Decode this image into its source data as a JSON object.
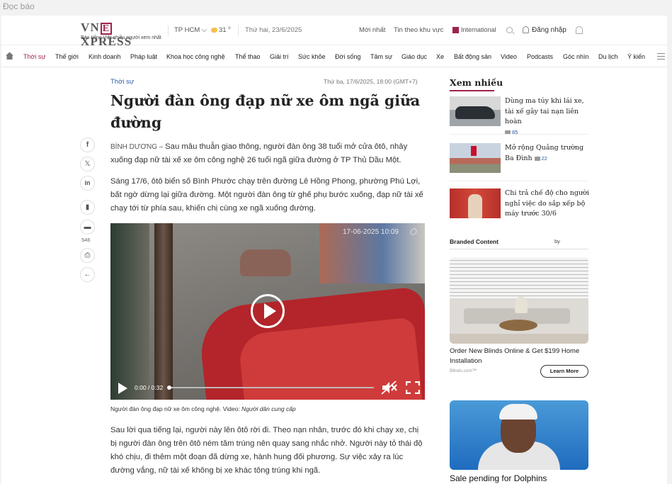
{
  "window": {
    "title": "Đọc báo"
  },
  "header": {
    "logo_text_left": "VN",
    "logo_text_e": "E",
    "logo_text_right": "XPRESS",
    "tagline": "Báo tiếng Việt nhiều người xem nhất",
    "city": "TP HCM",
    "temperature": "31",
    "temp_unit": "o",
    "date": "Thứ hai, 23/6/2025",
    "latest": "Mới nhất",
    "local_news": "Tin theo khu vực",
    "international": "International",
    "login": "Đăng nhập"
  },
  "nav": {
    "items": [
      "Thời sự",
      "Thế giới",
      "Kinh doanh",
      "Pháp luật",
      "Khoa học công nghệ",
      "Thể thao",
      "Giải trí",
      "Sức khỏe",
      "Đời sống",
      "Tâm sự",
      "Giáo dục",
      "Xe",
      "Bất động sản",
      "Video",
      "Podcasts",
      "Góc nhìn",
      "Du lịch",
      "Ý kiến"
    ],
    "active": "Thời sự"
  },
  "article": {
    "category": "Thời sự",
    "date": "Thứ ba, 17/6/2025, 18:00 (GMT+7)",
    "title": "Người đàn ông đạp nữ xe ôm ngã giữa đường",
    "location": "BÌNH DƯƠNG",
    "location_dash": " – ",
    "lead": "Sau mâu thuẫn giao thông, người đàn ông 38 tuổi mở cửa ôtô, nhảy xuống đạp nữ tài xế xe ôm công nghệ 26 tuổi ngã giữa đường ở TP Thủ Dầu Một.",
    "para1": "Sáng 17/6, ôtô biển số Bình Phước chạy trên đường Lê Hồng Phong, phường Phú Lợi, bất ngờ dừng lại giữa đường. Một người đàn ông từ ghế phụ bước xuống, đạp nữ tài xế chạy tới từ phía sau, khiến chị cùng xe ngã xuống đường.",
    "para2": "Sau lời qua tiếng lại, người này lên ôtô rời đi. Theo nạn nhân, trước đó khi chạy xe, chị bị người đàn ông trên ôtô ném tăm trúng nên quay sang nhắc nhở. Người này tỏ thái độ khó chịu, đi thêm một đoạn đã dừng xe, hành hung đối phương. Sự việc xảy ra lúc đường vắng, nữ tài xế không bị xe khác tông trúng khi ngã.",
    "comment_count": "546",
    "video": {
      "timestamp": "17-06-2025  10:09",
      "time": "0:00 / 0:32",
      "progress": 0
    },
    "caption": "Người đàn ông đạp nữ xe ôm công nghệ. Video: ",
    "caption_source": "Người dân cung cấp"
  },
  "sidebar": {
    "most_read_title": "Xem nhiều",
    "items": [
      {
        "title": "Dùng ma túy khi lái xe, tài xế gây tai nạn liên hoàn",
        "comments": "85"
      },
      {
        "title": "Mở rộng Quảng trường Ba Đình",
        "comments": "22"
      },
      {
        "title": "Chi trả chế độ cho người nghỉ việc do sắp xếp bộ máy trước 30/6",
        "comments": ""
      }
    ],
    "branded": {
      "title": "Branded Content",
      "by": "by",
      "ad1_title": "Order New Blinds Online & Get $199 Home Installation",
      "ad1_source": "Blinds.com™",
      "ad1_button": "Learn More",
      "ad2_title": "Sale pending for Dolphins"
    }
  },
  "colors": {
    "brand": "#9f224e",
    "link": "#2a5aa7"
  }
}
